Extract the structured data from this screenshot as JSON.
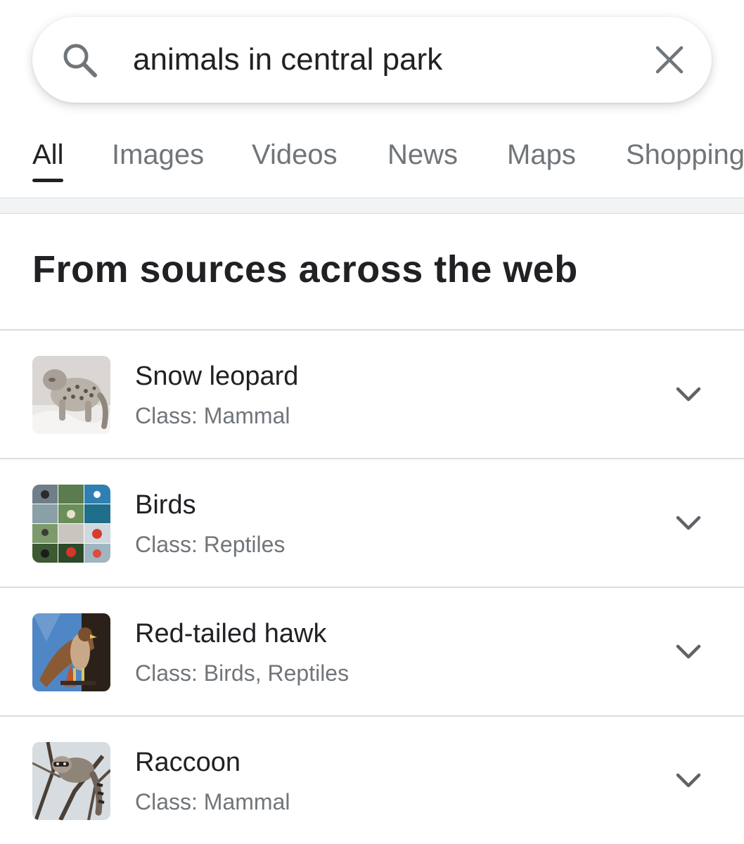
{
  "search": {
    "query": "animals in central park"
  },
  "tabs": [
    {
      "label": "All",
      "active": true
    },
    {
      "label": "Images",
      "active": false
    },
    {
      "label": "Videos",
      "active": false
    },
    {
      "label": "News",
      "active": false
    },
    {
      "label": "Maps",
      "active": false
    },
    {
      "label": "Shopping",
      "active": false
    }
  ],
  "section": {
    "heading": "From sources across the web"
  },
  "results": [
    {
      "title": "Snow leopard",
      "subtitle": "Class: Mammal",
      "thumbnail": "snow-leopard-photo"
    },
    {
      "title": "Birds",
      "subtitle": "Class: Reptiles",
      "thumbnail": "birds-collage-photo"
    },
    {
      "title": "Red-tailed hawk",
      "subtitle": "Class: Birds, Reptiles",
      "thumbnail": "red-tailed-hawk-photo"
    },
    {
      "title": "Raccoon",
      "subtitle": "Class: Mammal",
      "thumbnail": "raccoon-photo"
    }
  ],
  "colors": {
    "text_primary": "#202124",
    "text_secondary": "#70757a",
    "divider": "#dadce0",
    "icon": "#70757a"
  }
}
